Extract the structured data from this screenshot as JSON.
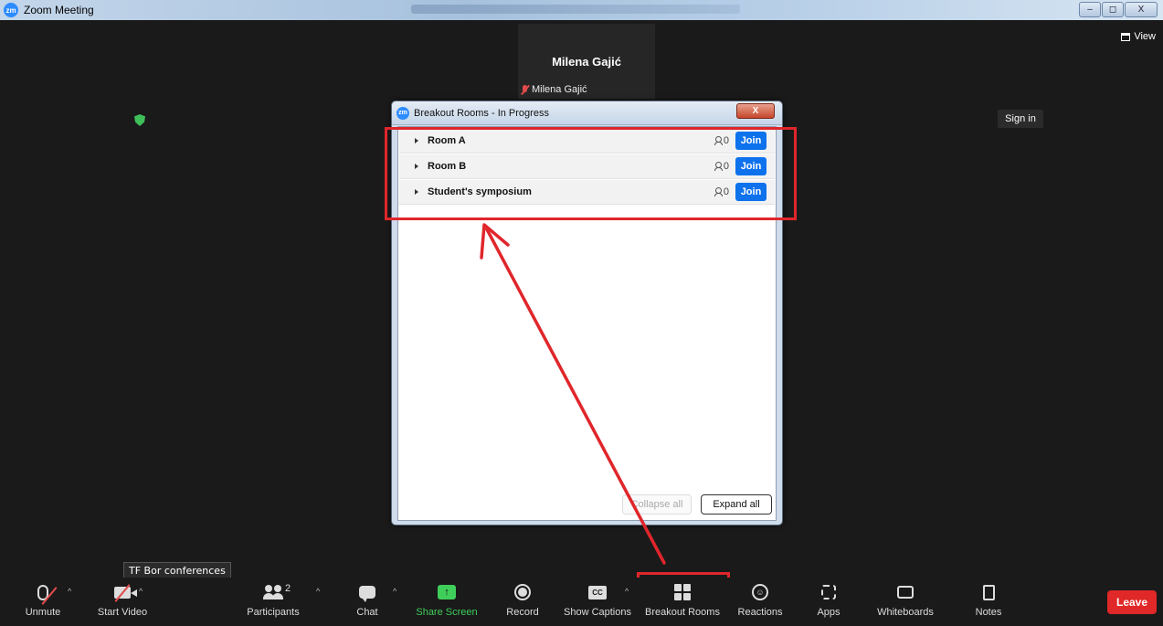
{
  "window": {
    "title": "Zoom Meeting",
    "logo": "zm",
    "minimize": "–",
    "restore": "◻",
    "close": "X"
  },
  "stage": {
    "view_label": "View",
    "sign_in": "Sign in",
    "participant_name": "Milena Gajić",
    "participant_label": "Milena Gajić"
  },
  "dialog": {
    "title": "Breakout Rooms - In Progress",
    "logo": "zm",
    "close": "X",
    "rooms": [
      {
        "name": "Room A",
        "count": "0",
        "join": "Join"
      },
      {
        "name": "Room B",
        "count": "0",
        "join": "Join"
      },
      {
        "name": "Student's symposium",
        "count": "0",
        "join": "Join"
      }
    ],
    "collapse_all": "Collapse all",
    "expand_all": "Expand all"
  },
  "tooltip": "TF Bor conferences",
  "toolbar": {
    "unmute": "Unmute",
    "start_video": "Start Video",
    "participants": "Participants",
    "participants_count": "2",
    "chat": "Chat",
    "share_screen": "Share Screen",
    "record": "Record",
    "show_captions": "Show Captions",
    "cc": "CC",
    "breakout_rooms": "Breakout Rooms",
    "reactions": "Reactions",
    "apps": "Apps",
    "whiteboards": "Whiteboards",
    "notes": "Notes",
    "leave": "Leave"
  },
  "colors": {
    "accent": "#0e72ed",
    "annotation": "#e0262b",
    "share_green": "#3fce5a",
    "leave_red": "#e02828"
  }
}
